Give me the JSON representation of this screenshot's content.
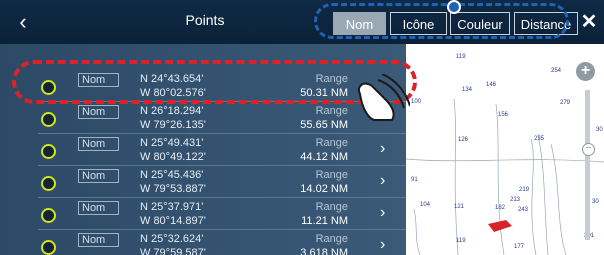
{
  "header": {
    "title": "Points",
    "back_icon": "chevron-left-icon",
    "close_icon": "close-icon",
    "sort_buttons": [
      {
        "label": "Nom",
        "active": true
      },
      {
        "label": "Icône",
        "active": false
      },
      {
        "label": "Couleur",
        "active": false
      },
      {
        "label": "Distance",
        "active": false
      }
    ]
  },
  "list": {
    "rows": [
      {
        "name": "Nom",
        "lat": "N 24°43.654'",
        "lon": "W 80°02.576'",
        "range_label": "Range",
        "range": "50.31 NM"
      },
      {
        "name": "Nom",
        "lat": "N 26°18.294'",
        "lon": "W 79°26.135'",
        "range_label": "Range",
        "range": "55.65 NM"
      },
      {
        "name": "Nom",
        "lat": "N 25°49.431'",
        "lon": "W 80°49.122'",
        "range_label": "Range",
        "range": "44.12 NM"
      },
      {
        "name": "Nom",
        "lat": "N 25°45.436'",
        "lon": "W 79°53.887'",
        "range_label": "Range",
        "range": "14.02 NM"
      },
      {
        "name": "Nom",
        "lat": "N 25°37.971'",
        "lon": "W 80°14.897'",
        "range_label": "Range",
        "range": "11.21 NM"
      },
      {
        "name": "Nom",
        "lat": "N 25°32.624'",
        "lon": "W 79°59.587'",
        "range_label": "Range",
        "range": "3.618 NM"
      }
    ]
  },
  "chart": {
    "soundings": [
      "119",
      "254",
      "134",
      "146",
      "100",
      "279",
      "156",
      "126",
      "235",
      "30",
      "91",
      "104",
      "121",
      "219",
      "213",
      "182",
      "243",
      "30",
      "301",
      "119",
      "177"
    ]
  },
  "colors": {
    "header_bg": "#0f2a45",
    "list_bg": "#34536f",
    "highlight": "#d8232a",
    "callout": "#1e63b5",
    "waypoint_ring": "#d6e21b"
  }
}
